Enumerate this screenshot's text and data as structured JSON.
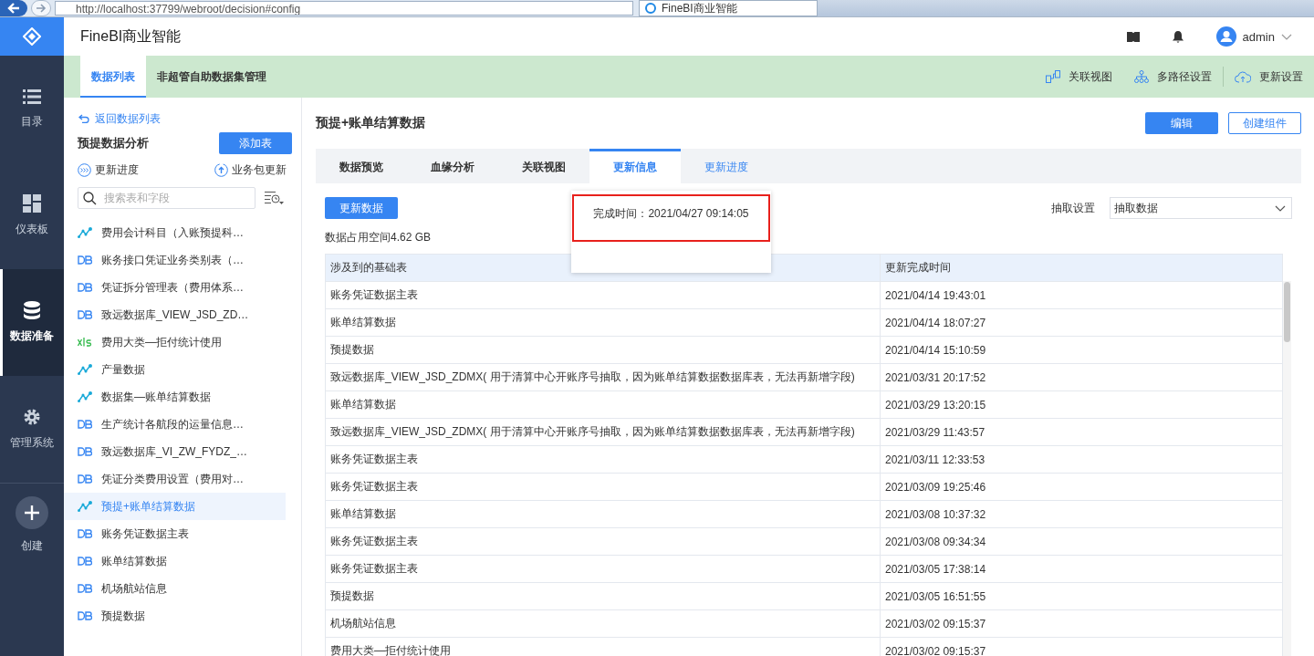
{
  "browser": {
    "url": "http://localhost:37799/webroot/decision#config",
    "tab_title": "FineBI商业智能"
  },
  "app_title": "FineBI商业智能",
  "user": "admin",
  "nav": [
    {
      "label": "目录",
      "kind": "list",
      "selected": false
    },
    {
      "label": "仪表板",
      "kind": "dashboard",
      "selected": false
    },
    {
      "label": "数据准备",
      "kind": "database",
      "selected": true
    },
    {
      "label": "管理系统",
      "kind": "gear",
      "selected": false
    },
    {
      "label": "创建",
      "kind": "plus",
      "selected": false
    }
  ],
  "subtabs": [
    {
      "label": "数据列表",
      "selected": true
    },
    {
      "label": "非超管自助数据集管理",
      "selected": false
    }
  ],
  "sub_actions": [
    {
      "label": "关联视图",
      "kind": "relation"
    },
    {
      "label": "多路径设置",
      "kind": "tree"
    },
    {
      "label": "更新设置",
      "kind": "cloud"
    }
  ],
  "sidebar": {
    "back": "返回数据列表",
    "package": "预提数据分析",
    "add_button": "添加表",
    "progress": "更新进度",
    "package_update": "业务包更新",
    "search_placeholder": "搜索表和字段",
    "items": [
      {
        "label": "费用会计科目（入账预提科…",
        "kind": "self",
        "selected": false
      },
      {
        "label": "账务接口凭证业务类别表（…",
        "kind": "db",
        "selected": false
      },
      {
        "label": "凭证拆分管理表（费用体系…",
        "kind": "db",
        "selected": false
      },
      {
        "label": "致远数据库_VIEW_JSD_ZD…",
        "kind": "db",
        "selected": false
      },
      {
        "label": "费用大类—拒付统计使用",
        "kind": "xls",
        "selected": false
      },
      {
        "label": "产量数据",
        "kind": "self",
        "selected": false
      },
      {
        "label": "数据集—账单结算数据",
        "kind": "self",
        "selected": false
      },
      {
        "label": "生产统计各航段的运量信息…",
        "kind": "db",
        "selected": false
      },
      {
        "label": "致远数据库_VI_ZW_FYDZ_…",
        "kind": "db",
        "selected": false
      },
      {
        "label": "凭证分类费用设置（费用对…",
        "kind": "db",
        "selected": false
      },
      {
        "label": "预提+账单结算数据",
        "kind": "self",
        "selected": true
      },
      {
        "label": "账务凭证数据主表",
        "kind": "db",
        "selected": false
      },
      {
        "label": "账单结算数据",
        "kind": "db",
        "selected": false
      },
      {
        "label": "机场航站信息",
        "kind": "db",
        "selected": false
      },
      {
        "label": "预提数据",
        "kind": "db",
        "selected": false
      }
    ]
  },
  "main": {
    "title": "预提+账单结算数据",
    "edit_button": "编辑",
    "create_button": "创建组件",
    "tabs": [
      {
        "label": "数据预览",
        "selected": false
      },
      {
        "label": "血缘分析",
        "selected": false
      },
      {
        "label": "关联视图",
        "selected": false
      },
      {
        "label": "更新信息",
        "selected": true
      },
      {
        "label": "更新进度",
        "selected": false
      }
    ],
    "update_button": "更新数据",
    "space": "数据占用空间4.62 GB",
    "extract_label": "抽取设置",
    "extract_value": "抽取数据",
    "tooltip": "完成时间：2021/04/27 09:14:05",
    "table": {
      "columns": [
        "涉及到的基础表",
        "更新完成时间"
      ],
      "rows": [
        [
          "账务凭证数据主表",
          "2021/04/14 19:43:01"
        ],
        [
          "账单结算数据",
          "2021/04/14 18:07:27"
        ],
        [
          "预提数据",
          "2021/04/14 15:10:59"
        ],
        [
          "致远数据库_VIEW_JSD_ZDMX( 用于清算中心开账序号抽取，因为账单结算数据数据库表，无法再新增字段)",
          "2021/03/31 20:17:52"
        ],
        [
          "账单结算数据",
          "2021/03/29 13:20:15"
        ],
        [
          "致远数据库_VIEW_JSD_ZDMX( 用于清算中心开账序号抽取，因为账单结算数据数据库表，无法再新增字段)",
          "2021/03/29 11:43:57"
        ],
        [
          "账务凭证数据主表",
          "2021/03/11 12:33:53"
        ],
        [
          "账务凭证数据主表",
          "2021/03/09 19:25:46"
        ],
        [
          "账单结算数据",
          "2021/03/08 10:37:32"
        ],
        [
          "账务凭证数据主表",
          "2021/03/08 09:34:34"
        ],
        [
          "账务凭证数据主表",
          "2021/03/05 17:38:14"
        ],
        [
          "预提数据",
          "2021/03/05 16:51:55"
        ],
        [
          "机场航站信息",
          "2021/03/02 09:15:37"
        ],
        [
          "费用大类—拒付统计使用",
          "2021/03/02 09:15:37"
        ]
      ]
    }
  }
}
